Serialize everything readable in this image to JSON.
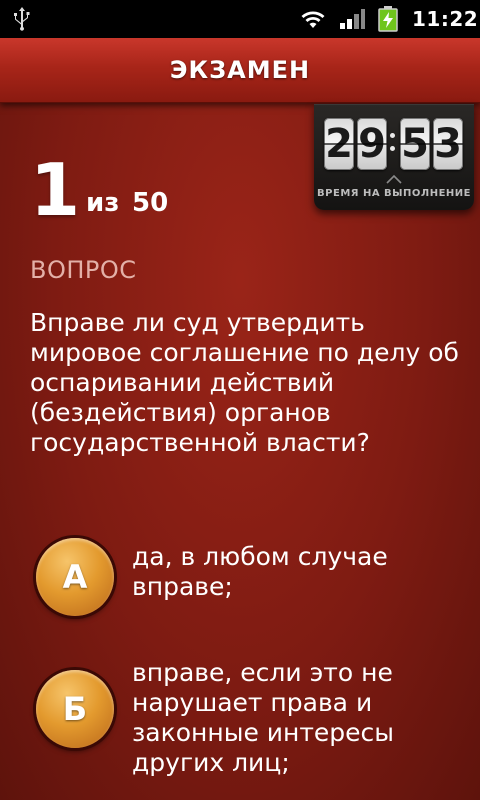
{
  "statusbar": {
    "time": "11:22",
    "icons": [
      "usb-icon",
      "wifi-icon",
      "signal-icon",
      "battery-charging-icon"
    ]
  },
  "header": {
    "title": "ЭКЗАМЕН"
  },
  "timer": {
    "minutes": [
      "2",
      "9"
    ],
    "seconds": [
      "5",
      "3"
    ],
    "label": "ВРЕМЯ НА ВЫПОЛНЕНИЕ"
  },
  "progress": {
    "current": "1",
    "of": "из",
    "total": "50"
  },
  "question": {
    "label": "ВОПРОС",
    "text": "Вправе ли суд утвердить мировое соглашение по делу об оспаривании действий (бездействия) органов государственной власти?"
  },
  "answers": [
    {
      "letter": "А",
      "text": "да, в любом случае вправе;"
    },
    {
      "letter": "Б",
      "text": "вправе, если это не нарушает права и законные интересы других лиц;"
    }
  ],
  "colors": {
    "background": "#7e1b12",
    "header": "#a82519",
    "answer_button": "#e39a2e",
    "section_label": "#e3b0a8"
  }
}
